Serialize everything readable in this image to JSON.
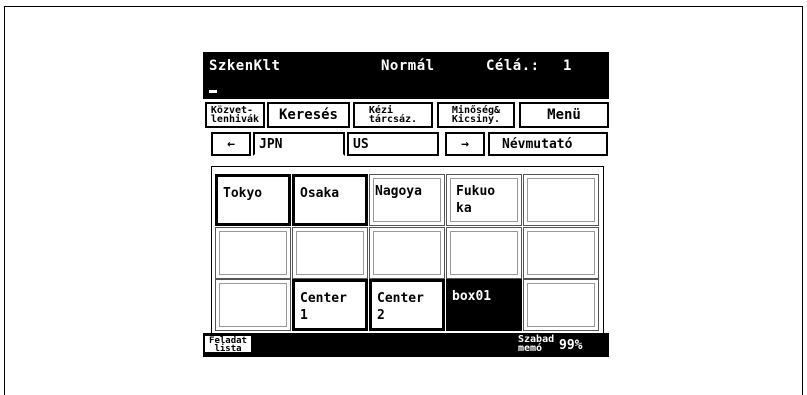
{
  "status": {
    "mode_title": "SzkenKlt",
    "quality": "Normál",
    "target_label": "Célá.:",
    "target_count": "1"
  },
  "tabs": {
    "intermediate": "Közvet-\nlenhivák",
    "search": "Keresés",
    "manual": "Kézi\ntárcsáz.",
    "quality": "Minőség&\nKicsiny.",
    "menu": "Menü"
  },
  "nav": {
    "prev_arrow": "←",
    "next_arrow": "→",
    "group_1": "JPN",
    "group_2": "US",
    "index": "Névmutató"
  },
  "destinations": [
    [
      "Tokyo",
      "Osaka",
      "Nagoya",
      "Fukuo\nka",
      ""
    ],
    [
      "",
      "",
      "",
      "",
      ""
    ],
    [
      "",
      "Center\n1",
      "Center\n2",
      "box01",
      ""
    ]
  ],
  "footer": {
    "job_list": "Feladat\nlista",
    "free_memory_label": "Szabad\nmemó",
    "free_memory_value": "99%"
  }
}
